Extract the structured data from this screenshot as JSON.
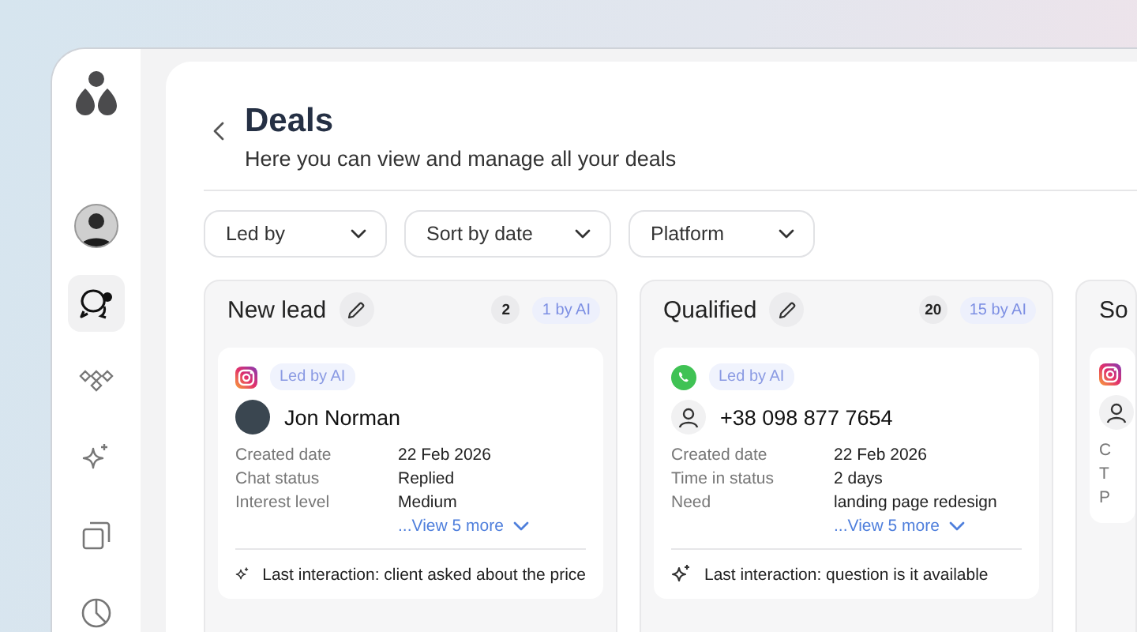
{
  "sidebar": {
    "items": [
      {
        "kind": "profile",
        "selected": false
      },
      {
        "kind": "chat",
        "selected": true
      },
      {
        "kind": "diamonds",
        "selected": false
      },
      {
        "kind": "sparkle",
        "selected": false
      },
      {
        "kind": "copy",
        "selected": false
      },
      {
        "kind": "pie",
        "selected": false
      }
    ]
  },
  "header": {
    "title": "Deals",
    "subtitle": "Here you can view and manage all your deals"
  },
  "filters": [
    {
      "label": "Led by"
    },
    {
      "label": "Sort by date"
    },
    {
      "label": "Platform"
    }
  ],
  "columns": [
    {
      "title": "New lead",
      "count": "2",
      "ai_count": "1 by AI",
      "cards": [
        {
          "platform": {
            "kind": "instagram"
          },
          "badge": "Led by AI",
          "avatar": {
            "kind": "photo"
          },
          "name": "Jon Norman",
          "fields": [
            {
              "label": "Created date",
              "value": "22 Feb 2026"
            },
            {
              "label": "Chat status",
              "value": "Replied"
            },
            {
              "label": "Interest level",
              "value": "Medium"
            }
          ],
          "more": "...View 5 more",
          "last": "Last interaction: client asked about the price"
        }
      ]
    },
    {
      "title": "Qualified",
      "count": "20",
      "ai_count": "15 by AI",
      "cards": [
        {
          "platform": {
            "kind": "whatsapp"
          },
          "badge": "Led by AI",
          "avatar": {
            "kind": "person"
          },
          "name": "+38 098 877 7654",
          "fields": [
            {
              "label": "Created date",
              "value": "22 Feb 2026"
            },
            {
              "label": "Time in status",
              "value": "2 days"
            },
            {
              "label": "Need",
              "value": "landing page redesign"
            }
          ],
          "more": "...View 5 more",
          "last": "Last interaction: question is it available"
        }
      ]
    },
    {
      "title": "So",
      "cards": [
        {
          "platform": {
            "kind": "instagram"
          },
          "avatar": {
            "kind": "person"
          },
          "fields": [
            {
              "label": "C"
            },
            {
              "label": "T"
            },
            {
              "label": "P"
            }
          ]
        }
      ]
    }
  ]
}
